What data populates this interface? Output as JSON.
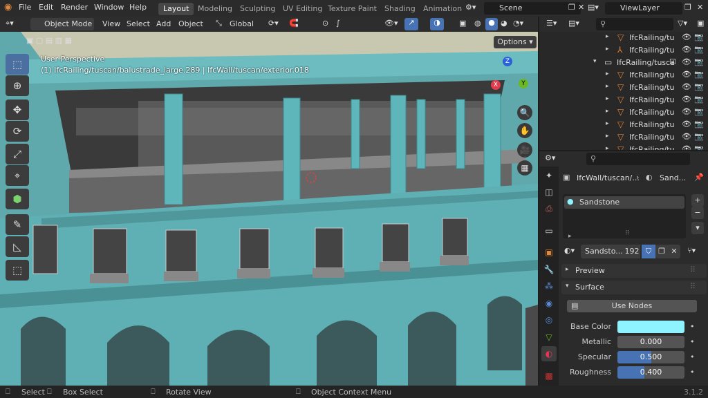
{
  "topbar": {
    "menus": [
      "File",
      "Edit",
      "Render",
      "Window",
      "Help"
    ],
    "workspaces": [
      "Layout",
      "Modeling",
      "Sculpting",
      "UV Editing",
      "Texture Paint",
      "Shading",
      "Animation"
    ],
    "active_workspace": "Layout",
    "scene": "Scene",
    "view_layer": "ViewLayer"
  },
  "viewport_header": {
    "mode": "Object Mode",
    "menus": [
      "View",
      "Select",
      "Add",
      "Object"
    ],
    "transform": "Global",
    "options": "Options"
  },
  "viewport": {
    "title": "User Perspective",
    "subtitle": "(1) IfcRailing/tuscan/balustrade_large.289 | IfcWall/tuscan/exterior.018",
    "gizmo": {
      "z": "Z",
      "y": "Y",
      "x": "X"
    }
  },
  "outliner": {
    "rows": [
      {
        "name": "IfcRailing/tu",
        "icon": "mesh-icon"
      },
      {
        "name": "IfcRailing/tu",
        "icon": "empty-icon"
      },
      {
        "name": "IfcRailing/tusca",
        "icon": "collection-icon",
        "checked": true
      },
      {
        "name": "IfcRailing/tu",
        "icon": "mesh-icon"
      },
      {
        "name": "IfcRailing/tu",
        "icon": "mesh-icon"
      },
      {
        "name": "IfcRailing/tu",
        "icon": "mesh-icon"
      },
      {
        "name": "IfcRailing/tu",
        "icon": "mesh-icon"
      },
      {
        "name": "IfcRailing/tu",
        "icon": "mesh-icon"
      },
      {
        "name": "IfcRailing/tu",
        "icon": "mesh-icon"
      },
      {
        "name": "IfcRailing/tu",
        "icon": "mesh-icon"
      }
    ]
  },
  "properties": {
    "breadcrumb_object": "IfcWall/tuscan/...",
    "breadcrumb_material": "Sand...",
    "slots": [
      "Sandstone"
    ],
    "material_name": "Sandsto...",
    "user_count": "192",
    "panels": {
      "preview": "Preview",
      "surface": "Surface"
    },
    "use_nodes": "Use Nodes",
    "fields": [
      {
        "label": "Base Color",
        "type": "color",
        "color": "#8ff3ff"
      },
      {
        "label": "Metallic",
        "type": "slider",
        "value": "0.000",
        "fraction": 0.0
      },
      {
        "label": "Specular",
        "type": "slider",
        "value": "0.500",
        "fraction": 0.5
      },
      {
        "label": "Roughness",
        "type": "slider",
        "value": "0.400",
        "fraction": 0.4
      }
    ]
  },
  "statusbar": {
    "select": "Select",
    "box_select": "Box Select",
    "rotate_view": "Rotate View",
    "context_menu": "Object Context Menu",
    "version": "3.1.2"
  },
  "colors": {
    "accent": "#4772b3",
    "selection": "#e2873b",
    "wall": "#5fa9ad"
  }
}
